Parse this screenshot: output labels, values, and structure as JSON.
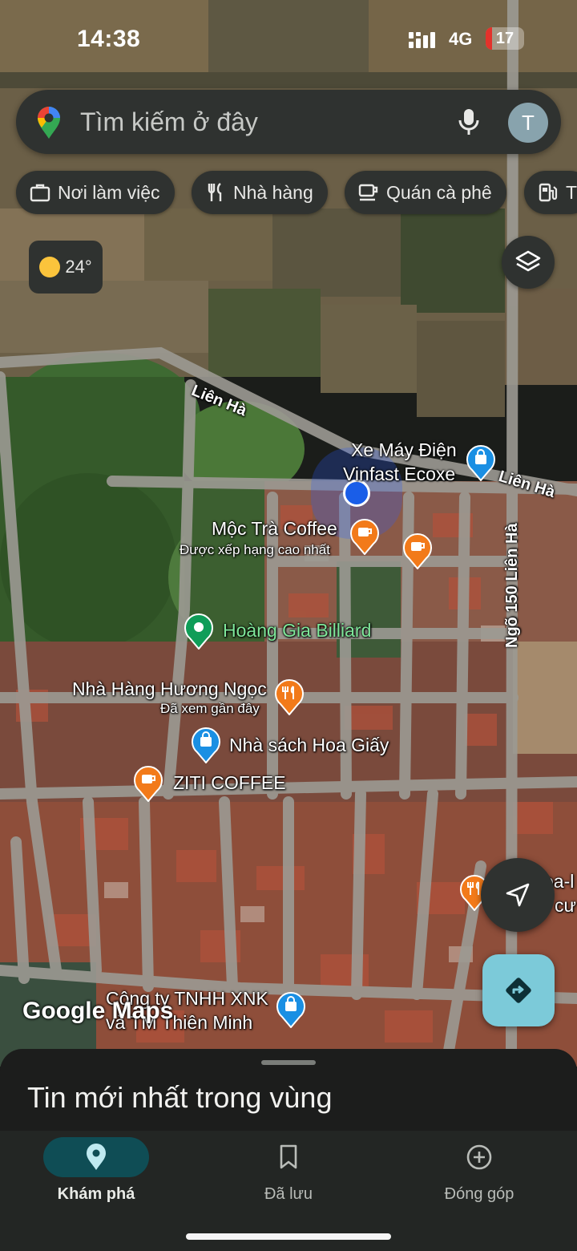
{
  "status_bar": {
    "time": "14:38",
    "network": "4G",
    "battery": "17"
  },
  "search": {
    "placeholder": "Tìm kiếm ở đây",
    "avatar_initial": "T"
  },
  "chips": [
    {
      "label": "Nơi làm việc",
      "icon": "briefcase-icon"
    },
    {
      "label": "Nhà hàng",
      "icon": "fork-knife-icon"
    },
    {
      "label": "Quán cà phê",
      "icon": "coffee-cup-icon"
    },
    {
      "label": "T",
      "icon": "gas-station-icon"
    }
  ],
  "weather": {
    "temperature": "24°",
    "icon": "sun-icon"
  },
  "map": {
    "roads": [
      {
        "name": "Liên Hà"
      },
      {
        "name": "Liên Hà"
      },
      {
        "name": "Ngõ 150 Liên Hà"
      }
    ],
    "places": [
      {
        "name": "Xe Máy Điện",
        "line2": "Vinfast Ecoxe",
        "type": "shopping",
        "color": "#1a8fe3"
      },
      {
        "name": "Mộc Trà Coffee",
        "subtitle": "Được xếp hạng cao nhất",
        "type": "cafe",
        "color": "#f27a1a"
      },
      {
        "name": "Hoàng Gia Billiard",
        "type": "recreation",
        "color": "#0f9d58"
      },
      {
        "name": "Nhà Hàng Hương Ngọc",
        "subtitle": "Đã xem gần đây",
        "type": "restaurant",
        "color": "#f27a1a"
      },
      {
        "name": "Nhà sách Hoa Giấy",
        "type": "shopping",
        "color": "#1a8fe3"
      },
      {
        "name": "ZITI COFFEE",
        "type": "cafe",
        "color": "#f27a1a"
      },
      {
        "name": "Công ty TNHH XNK",
        "line2": "và TM Thiên Minh",
        "type": "shopping",
        "color": "#1a8fe3"
      },
      {
        "name": "oa-l",
        "line2": "cư",
        "type": "restaurant",
        "color": "#f27a1a"
      }
    ],
    "attribution": "Google Maps"
  },
  "sheet": {
    "title": "Tin mới nhất trong vùng"
  },
  "nav": [
    {
      "label": "Khám phá",
      "icon": "location-pin-icon",
      "active": true
    },
    {
      "label": "Đã lưu",
      "icon": "bookmark-icon",
      "active": false
    },
    {
      "label": "Đóng góp",
      "icon": "add-circle-icon",
      "active": false
    }
  ]
}
